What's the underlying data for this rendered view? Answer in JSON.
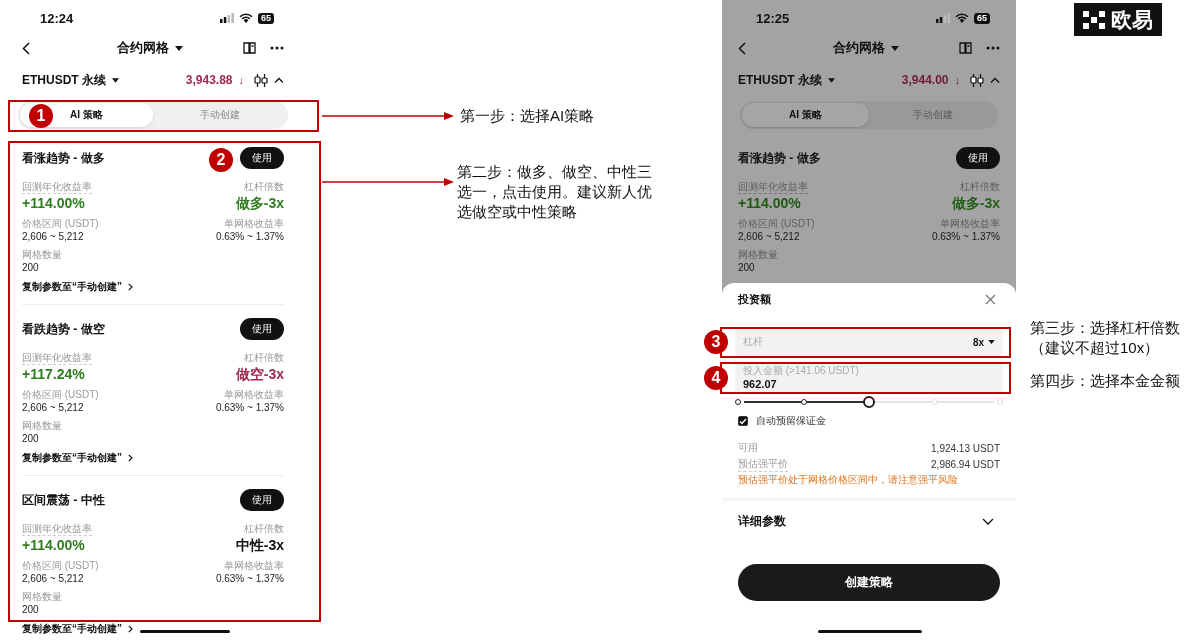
{
  "logo": {
    "text": "欧易"
  },
  "screens": [
    {
      "time": "12:24",
      "battery": "65",
      "title": "合约网格",
      "pair": "ETHUSDT 永续",
      "price": "3,943.88",
      "price_arrow": "↓",
      "dimmed": false,
      "tabs": [
        {
          "label": "AI 策略",
          "selected": true
        },
        {
          "label": "手动创建",
          "selected": false
        }
      ],
      "strategies": [
        {
          "title": "看涨趋势 - 做多",
          "button": "使用",
          "return_label": "回测年化收益率",
          "return": "+114.00%",
          "leverage_label": "杠杆倍数",
          "leverage": "做多-3x",
          "color": "#2f7d1e",
          "range_label": "价格区间 (USDT)",
          "range": "2,606 ~ 5,212",
          "rate_label": "单网格收益率",
          "rate": "0.63% ~ 1.37%",
          "count_label": "网格数量",
          "count": "200",
          "copy_link": "复制参数至“手动创建”"
        },
        {
          "title": "看跌趋势 - 做空",
          "button": "使用",
          "return_label": "回测年化收益率",
          "return": "+117.24%",
          "leverage_label": "杠杆倍数",
          "leverage": "做空-3x",
          "color": "#a2294f",
          "range_label": "价格区间 (USDT)",
          "range": "2,606 ~ 5,212",
          "rate_label": "单网格收益率",
          "rate": "0.63% ~ 1.37%",
          "count_label": "网格数量",
          "count": "200",
          "copy_link": "复制参数至“手动创建”"
        },
        {
          "title": "区间震荡 - 中性",
          "button": "使用",
          "return_label": "回测年化收益率",
          "return": "+114.00%",
          "leverage_label": "杠杆倍数",
          "leverage": "中性-3x",
          "color": "#111111",
          "range_label": "价格区间 (USDT)",
          "range": "2,606 ~ 5,212",
          "rate_label": "单网格收益率",
          "rate": "0.63% ~ 1.37%",
          "count_label": "网格数量",
          "count": "200",
          "copy_link": "复制参数至“手动创建”"
        }
      ]
    },
    {
      "time": "12:25",
      "battery": "65",
      "title": "合约网格",
      "pair": "ETHUSDT 永续",
      "price": "3,944.00",
      "price_arrow": "↓",
      "dimmed": true,
      "tabs": [
        {
          "label": "AI 策略",
          "selected": true
        },
        {
          "label": "手动创建",
          "selected": false
        }
      ],
      "strategies": [
        {
          "title": "看涨趋势 - 做多",
          "button": "使用",
          "return_label": "回测年化收益率",
          "return": "+114.00%",
          "leverage_label": "杠杆倍数",
          "leverage": "做多-3x",
          "color": "#245f17",
          "range_label": "价格区间 (USDT)",
          "range": "2,606 ~ 5,212",
          "rate_label": "单网格收益率",
          "rate": "0.63% ~ 1.37%",
          "count_label": "网格数量",
          "count": "200"
        }
      ],
      "sheet": {
        "title": "投资额",
        "leverage_field": {
          "placeholder": "杠杆",
          "value": "8x"
        },
        "amount_field": {
          "label": "投入金额 (>141.06 USDT)",
          "value": "962.07"
        },
        "slider": {
          "level": 0.5
        },
        "checkbox": {
          "label": "自动预留保证金",
          "checked": true
        },
        "rows": [
          {
            "label": "可用",
            "value": "1,924.13 USDT"
          },
          {
            "label": "预估强平价",
            "value": "2,986.94 USDT"
          }
        ],
        "warning": "预估强平价处于网格价格区间中，请注意强平风险",
        "details": {
          "label": "详细参数",
          "expanded": false
        },
        "create_button": "创建策略"
      }
    }
  ],
  "markers": [
    "1",
    "2",
    "3",
    "4"
  ],
  "steps": [
    "第一步：选择AI策略",
    "第二步：做多、做空、中性三选一，点击使用。建议新人优选做空或中性策略",
    "第三步：选择杠杆倍数（建议不超过10x）",
    "第四步：选择本金金额"
  ]
}
